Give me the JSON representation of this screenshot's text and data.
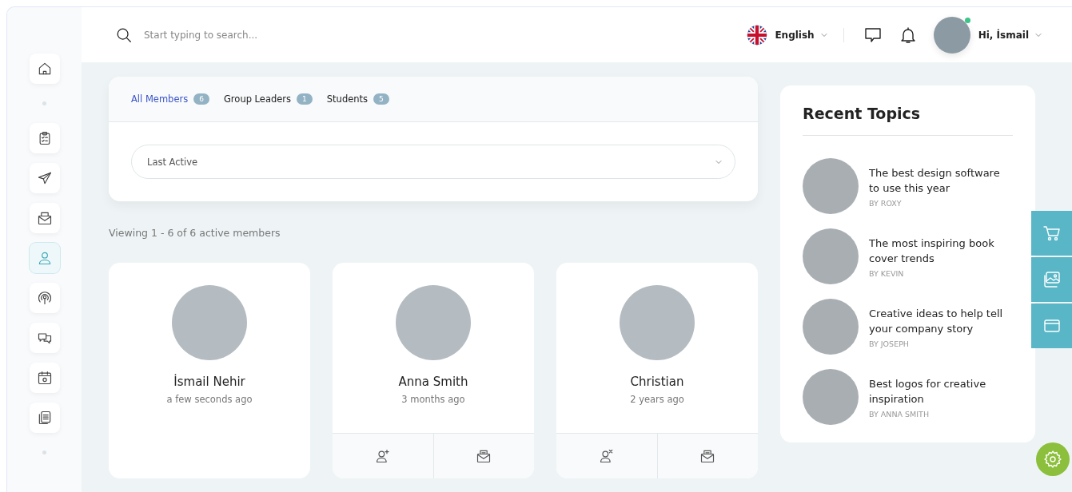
{
  "sidebar": {
    "items": [
      {
        "kind": "icon",
        "selected": false
      },
      {
        "kind": "dot"
      },
      {
        "kind": "icon",
        "selected": false
      },
      {
        "kind": "icon",
        "selected": false
      },
      {
        "kind": "icon",
        "selected": false
      },
      {
        "kind": "icon",
        "selected": true
      },
      {
        "kind": "icon",
        "selected": false
      },
      {
        "kind": "icon",
        "selected": false
      },
      {
        "kind": "icon",
        "selected": false
      },
      {
        "kind": "icon",
        "selected": false
      },
      {
        "kind": "dot"
      }
    ]
  },
  "header": {
    "search": {
      "placeholder": "Start typing to search..."
    },
    "language": "English",
    "user": {
      "greeting": "Hi,  İsmail",
      "online": true
    }
  },
  "tabs": [
    {
      "label": "All Members",
      "count": "6",
      "selected": true
    },
    {
      "label": "Group Leaders",
      "count": "1",
      "selected": false
    },
    {
      "label": "Students",
      "count": "5",
      "selected": false
    }
  ],
  "sort": {
    "value": "Last Active"
  },
  "viewing": "Viewing 1 - 6 of 6 active members",
  "members": [
    {
      "name": "İsmail Nehir",
      "active": "a few seconds ago"
    },
    {
      "name": "Anna Smith",
      "active": "3 months ago",
      "actions": [
        {
          "kind": "add-friend"
        },
        {
          "kind": "message"
        }
      ]
    },
    {
      "name": "Christian",
      "active": "2 years ago",
      "actions": [
        {
          "kind": "remove-friend"
        },
        {
          "kind": "message"
        }
      ]
    }
  ],
  "recent_topics": {
    "title": "Recent Topics",
    "items": [
      {
        "title": "The best design software to use this year",
        "author": "BY ROXY"
      },
      {
        "title": "The most inspiring book cover trends",
        "author": "BY KEVIN"
      },
      {
        "title": "Creative ideas to help tell your company story",
        "author": "BY JOSEPH"
      },
      {
        "title": "Best logos for creative inspiration",
        "author": "BY ANNA SMITH"
      }
    ]
  },
  "side_panel": [
    {
      "kind": "cart"
    },
    {
      "kind": "images"
    },
    {
      "kind": "browser"
    }
  ]
}
